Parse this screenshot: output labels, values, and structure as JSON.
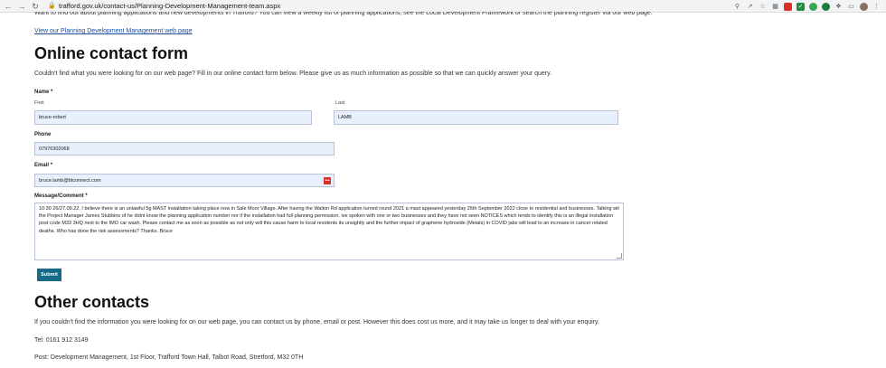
{
  "browser": {
    "url": "trafford.gov.uk/contact-us/Planning-Development-Management-team.aspx"
  },
  "page": {
    "intro_cut": "Want to find out about planning applications and new developments in Trafford? You can view a weekly list of planning applications, see the Local Development Framework or search the planning register via our web page.",
    "link_text": "View our Planning Development Management web page",
    "contact_heading": "Online contact form",
    "contact_intro": "Couldn't find what you were looking for on our web page? Fill in our online contact form below. Please give us as much information as possible so that we can quickly answer your query."
  },
  "form": {
    "name_label": "Name",
    "required_marker": "*",
    "first_label": "First",
    "last_label": "Last",
    "first_value": "bruce-robert",
    "last_value": "LAMB",
    "phone_label": "Phone",
    "phone_value": "07976302068",
    "email_label": "Email",
    "email_value": "bruce.lamb@btconnect.com",
    "message_label": "Message/Comment",
    "message_value": "10:30 26/27.09.22.       I believe there is an unlawful 5g MAST installation taking place now in Sale Moor Village. After having the Walton Rd application turned round 2021 a mast appeared yesterday 26th September 2022 close to residential and businesses. Talking wit the Project Manager James Stubbins of he didnt know the planning application number nor if the installation had full planning permission. ive spoken with one or two businesses and they have not seen NOTICES which tends to identify this is an illegal installation post code M33 3HQ next to the IMO car wash. Please contact me as soon as possible as not only will this cause harm to local residents its unsightly and the further impact of graphene hydroxide (Metals) in COVID jabs will lead to an increase in cancer related deaths. Who has done the risk assessments? Thanks. Bruce",
    "submit_label": "Submit"
  },
  "other": {
    "heading": "Other contacts",
    "intro": "If you couldn't find the information you were looking for on our web page, you can contact us by phone, email or post. However this does cost us more, and it may take us longer to deal with your enquiry.",
    "tel": "Tel: 0161 912 3149",
    "post": "Post: Development Management, 1st Floor, Trafford Town Hall, Talbot Road, Stretford, M32 0TH"
  },
  "icons": {
    "back": "back-arrow-icon",
    "forward": "forward-arrow-icon",
    "reload": "reload-icon",
    "lock": "lock-icon"
  },
  "colors": {
    "link": "#1a4f9c",
    "submit_bg": "#176b87",
    "field_bg": "#e8f0fe"
  }
}
